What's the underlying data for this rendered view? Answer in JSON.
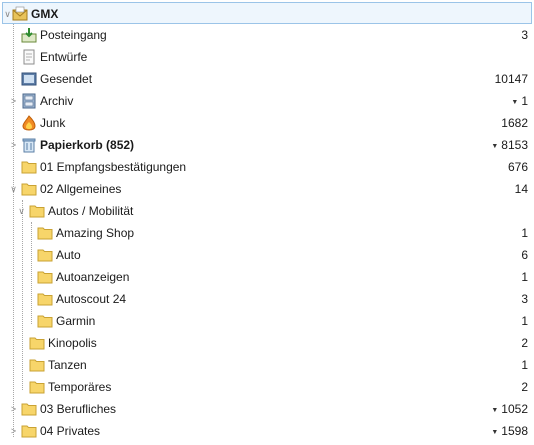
{
  "account": {
    "name": "GMX"
  },
  "folders": [
    {
      "label": "Posteingang",
      "count": "3"
    },
    {
      "label": "Entwürfe",
      "count": ""
    },
    {
      "label": "Gesendet",
      "count": "10147"
    },
    {
      "label": "Archiv",
      "count": "1"
    },
    {
      "label": "Junk",
      "count": "1682"
    },
    {
      "label": "Papierkorb (852)",
      "count": "8153"
    },
    {
      "label": "01 Empfangsbestätigungen",
      "count": "676"
    },
    {
      "label": "02 Allgemeines",
      "count": "14"
    },
    {
      "label": "Autos / Mobilität",
      "count": ""
    },
    {
      "label": "Amazing Shop",
      "count": "1"
    },
    {
      "label": "Auto",
      "count": "6"
    },
    {
      "label": "Autoanzeigen",
      "count": "1"
    },
    {
      "label": "Autoscout 24",
      "count": "3"
    },
    {
      "label": "Garmin",
      "count": "1"
    },
    {
      "label": "Kinopolis",
      "count": "2"
    },
    {
      "label": "Tanzen",
      "count": "1"
    },
    {
      "label": "Temporäres",
      "count": "2"
    },
    {
      "label": "03 Berufliches",
      "count": "1052"
    },
    {
      "label": "04 Privates",
      "count": "1598"
    }
  ],
  "icons": {
    "inbox": "inbox-icon",
    "drafts": "drafts-icon",
    "sent": "sent-icon",
    "archive": "archive-icon",
    "junk": "junk-icon",
    "trash": "trash-icon",
    "folder": "folder-icon",
    "account": "account-mail-icon"
  },
  "colors": {
    "folder": "#f7d56a",
    "selection_border": "#9bc4e8"
  }
}
